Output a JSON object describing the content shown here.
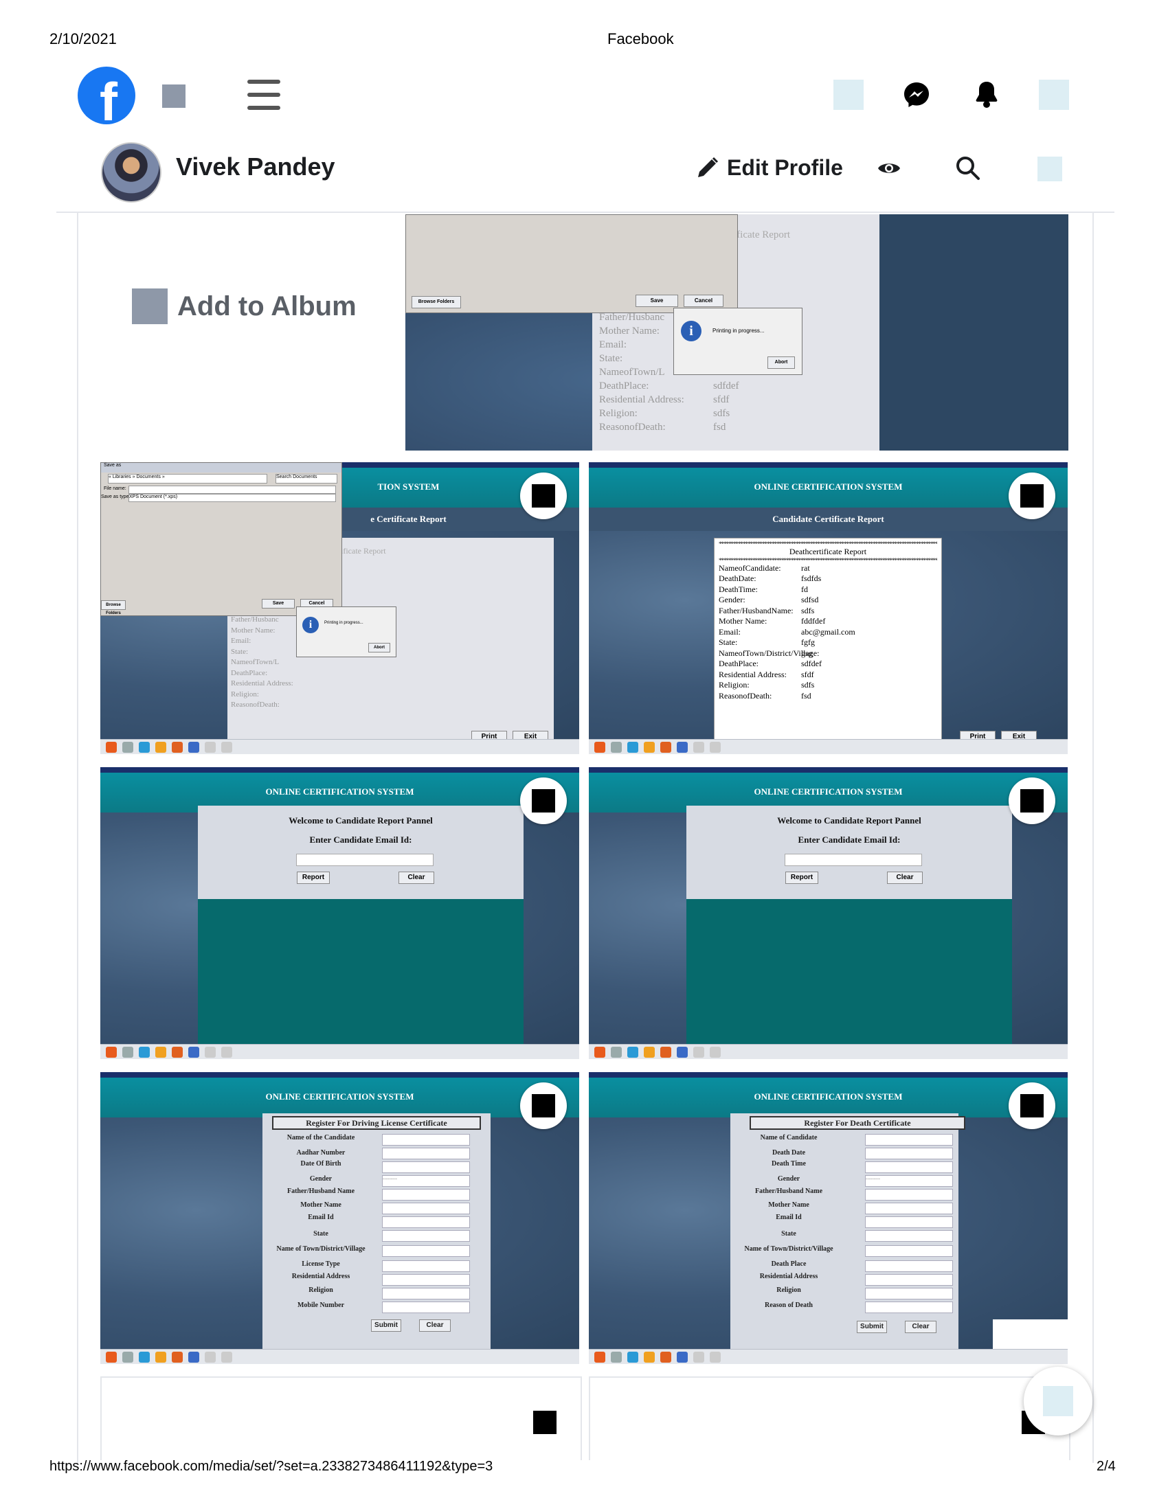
{
  "print_header": {
    "date": "2/10/2021",
    "title": "Facebook"
  },
  "print_footer": {
    "url": "https://www.facebook.com/media/set/?set=a.2338273486411192&type=3",
    "page": "2/4"
  },
  "nav": {
    "logo_letter": "f",
    "icons": [
      "facebook-logo",
      "menu-icon",
      "messenger-icon",
      "notifications-icon"
    ]
  },
  "profile": {
    "name": "Vivek Pandey",
    "edit_label": "Edit Profile"
  },
  "album": {
    "add_label": "Add to Album"
  },
  "app_title": "ONLINE CERTIFICATION SYSTEM",
  "report": {
    "subtitle": "Candidate Certificate Report",
    "subtitle_partial": "e Certificate Report",
    "title_partial": "TION SYSTEM",
    "doc_title": "Deathcertificate Report",
    "doc_title_partial": "ificate Report",
    "rows": [
      {
        "k": "NameofCandidate:",
        "v": "rat"
      },
      {
        "k": "DeathDate:",
        "v": "fsdfds"
      },
      {
        "k": "DeathTime:",
        "v": "fd"
      },
      {
        "k": "Gender:",
        "v": "sdfsd"
      },
      {
        "k": "Father/HusbandName:",
        "v": "sdfs"
      },
      {
        "k": "Mother Name:",
        "v": "fddfdef"
      },
      {
        "k": "Email:",
        "v": "abc@gmail.com"
      },
      {
        "k": "State:",
        "v": "fgfg"
      },
      {
        "k": "NameofTown/District/Village:",
        "v": "gsg"
      },
      {
        "k": "DeathPlace:",
        "v": "sdfdef"
      },
      {
        "k": "Residential Address:",
        "v": "sfdf"
      },
      {
        "k": "Religion:",
        "v": "sdfs"
      },
      {
        "k": "ReasonofDeath:",
        "v": "fsd"
      }
    ],
    "faded_rows": [
      "Father/Husbanc",
      "Mother Name:",
      "Email:",
      "State:",
      "NameofTown/L",
      "DeathPlace:",
      "Residential Address:",
      "Religion:",
      "ReasonofDeath:"
    ],
    "faded_vals": [
      "sdfdef",
      "sfdf",
      "sdfs",
      "fsd"
    ],
    "print_label": "Print",
    "exit_label": "Exit",
    "printing_msg": "Printing in progress...",
    "abort_label": "Abort",
    "save_label": "Save",
    "cancel_label": "Cancel",
    "browse_label": "Browse Folders",
    "file_name_label": "File name:",
    "save_type_label": "Save as type:",
    "save_type_value": "XPS Document (*.xps)",
    "path": "« Libraries » Documents »",
    "search_placeholder": "Search Documents"
  },
  "candidate_panel": {
    "welcome": "Welcome to Candidate Report Pannel",
    "prompt": "Enter Candidate Email Id:",
    "report_btn": "Report",
    "clear_btn": "Clear"
  },
  "driving_form": {
    "title": "Register For Driving License Certificate",
    "fields": [
      "Name of the Candidate",
      "Aadhar Number",
      "Date Of Birth",
      "Gender",
      "Father/Husband Name",
      "Mother Name",
      "Email Id",
      "State",
      "Name of Town/District/Village",
      "License Type",
      "Residential Address",
      "Religion",
      "Mobile Number"
    ],
    "submit": "Submit",
    "clear": "Clear"
  },
  "death_form": {
    "title": "Register For Death Certificate",
    "fields": [
      "Name of Candidate",
      "Death Date",
      "Death Time",
      "Gender",
      "Father/Husband Name",
      "Mother Name",
      "Email Id",
      "State",
      "Name of Town/District/Village",
      "Death Place",
      "Residential Address",
      "Religion",
      "Reason of Death"
    ],
    "submit": "Submit",
    "clear": "Clear"
  },
  "gender_select": "---------"
}
